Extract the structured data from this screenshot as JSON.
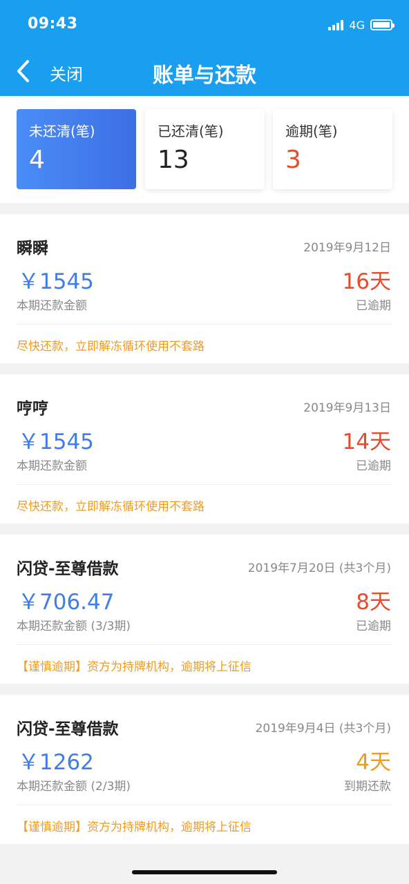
{
  "status_bar": {
    "time": "09:43",
    "network": "4G"
  },
  "nav": {
    "close_label": "关闭",
    "title": "账单与还款"
  },
  "tabs": [
    {
      "label": "未还清(笔)",
      "count": "4",
      "active": true
    },
    {
      "label": "已还清(笔)",
      "count": "13",
      "active": false
    },
    {
      "label": "逾期(笔)",
      "count": "3",
      "active": false
    }
  ],
  "bills": [
    {
      "name": "瞬瞬",
      "date": "2019年9月12日",
      "amount": "￥1545",
      "amount_label": "本期还款金额",
      "days": "16天",
      "status": "已逾期",
      "note": "尽快还款，立即解冻循环使用不套路"
    },
    {
      "name": "哼哼",
      "date": "2019年9月13日",
      "amount": "￥1545",
      "amount_label": "本期还款金额",
      "days": "14天",
      "status": "已逾期",
      "note": "尽快还款，立即解冻循环使用不套路"
    },
    {
      "name": "闪贷-至尊借款",
      "date": "2019年7月20日 (共3个月)",
      "amount": "￥706.47",
      "amount_label": "本期还款金额 (3/3期)",
      "days": "8天",
      "status": "已逾期",
      "note": "【谨慎逾期】资方为持牌机构，逾期将上征信"
    },
    {
      "name": "闪贷-至尊借款",
      "date": "2019年9月4日 (共3个月)",
      "amount": "￥1262",
      "amount_label": "本期还款金额 (2/3期)",
      "days": "4天",
      "status": "到期还款",
      "note": "【谨慎逾期】资方为持牌机构，逾期将上征信"
    }
  ],
  "colors": {
    "header": "#1a9ff0",
    "amount": "#3f7ee8",
    "overdue": "#e84a2a",
    "warning": "#f29a1c"
  }
}
